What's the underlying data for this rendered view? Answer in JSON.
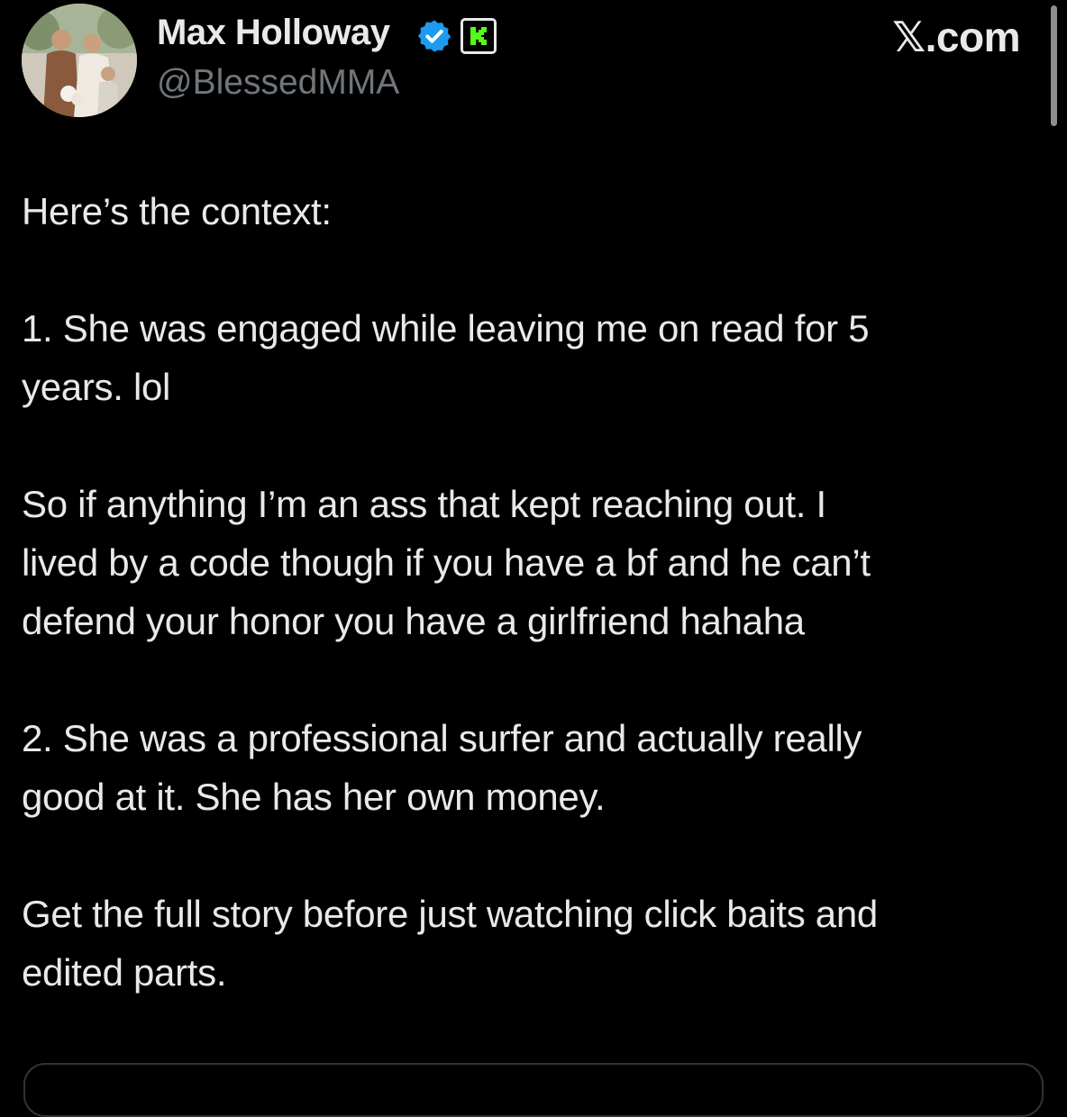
{
  "author": {
    "display_name": "Max Holloway",
    "handle": "@BlessedMMA",
    "verified_icon": "verified-badge-icon",
    "affiliate_badge_icon": "kick-k-icon",
    "colors": {
      "verified": "#1d9bf0",
      "affiliate": "#53fc18"
    }
  },
  "header": {
    "site_label": "𝕏.com"
  },
  "tweet": {
    "paragraphs": [
      {
        "lines": [
          "Here’s the context:"
        ]
      },
      {
        "lines": [
          "1. She was engaged while leaving me on read for 5",
          "years. lol"
        ]
      },
      {
        "lines": [
          "So if anything I’m an ass that kept reaching out. I",
          "lived by a code though if you have a bf and he can’t",
          "defend your honor you have a girlfriend hahaha"
        ]
      },
      {
        "lines": [
          "2. She was a professional surfer and actually really",
          "good at it. She has her own money."
        ]
      },
      {
        "lines": [
          "Get the full story before just watching click baits and",
          "edited parts."
        ]
      }
    ]
  },
  "colors": {
    "background": "#000000",
    "text": "#e7e9ea",
    "secondary_text": "#71767b",
    "border": "#2f3336"
  }
}
